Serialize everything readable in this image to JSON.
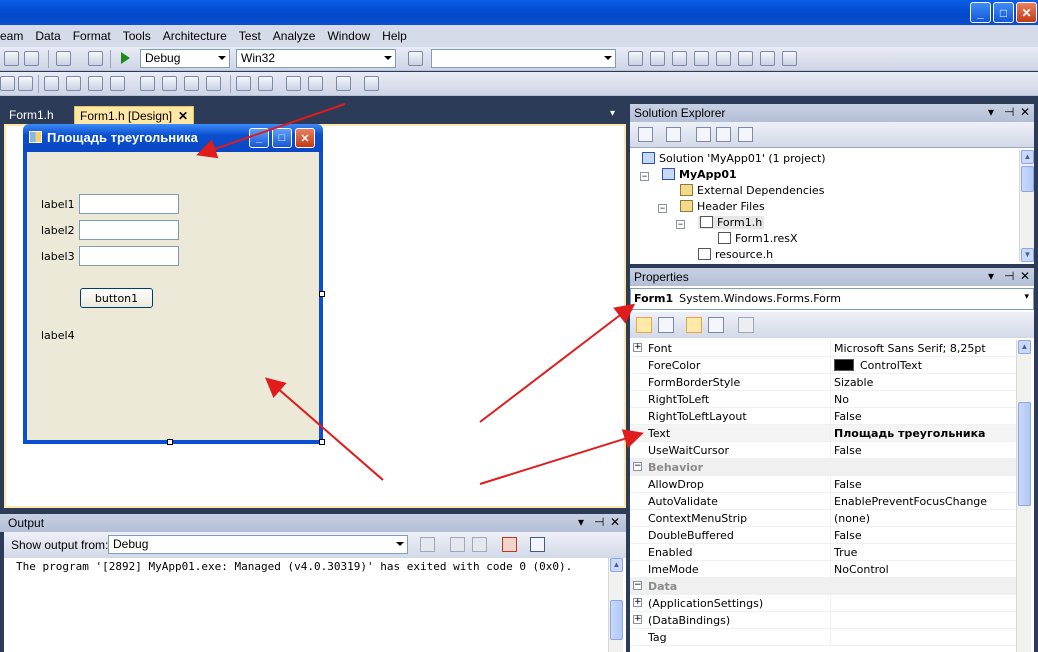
{
  "window": {
    "min": "_",
    "max": "□",
    "close": "✕"
  },
  "menu": [
    "eam",
    "Data",
    "Format",
    "Tools",
    "Architecture",
    "Test",
    "Analyze",
    "Window",
    "Help"
  ],
  "toolbar": {
    "config": "Debug",
    "platform": "Win32",
    "find": ""
  },
  "tabs": [
    {
      "label": "Form1.h"
    },
    {
      "label": "Form1.h [Design]",
      "close": "✕"
    }
  ],
  "form": {
    "title": "Площадь треугольника",
    "label1": "label1",
    "label2": "label2",
    "label3": "label3",
    "button": "button1",
    "label4": "label4"
  },
  "solution_explorer": {
    "title": "Solution Explorer",
    "items": [
      "Solution 'MyApp01' (1 project)",
      "MyApp01",
      "External Dependencies",
      "Header Files",
      "Form1.h",
      "Form1.resX",
      "resource.h"
    ]
  },
  "properties": {
    "title": "Properties",
    "object_name": "Form1",
    "object_type": "System.Windows.Forms.Form",
    "rows": [
      {
        "name": "Font",
        "value": "Microsoft Sans Serif; 8,25pt"
      },
      {
        "name": "ForeColor",
        "value": "ControlText"
      },
      {
        "name": "FormBorderStyle",
        "value": "Sizable"
      },
      {
        "name": "RightToLeft",
        "value": "No"
      },
      {
        "name": "RightToLeftLayout",
        "value": "False"
      },
      {
        "name": "Text",
        "value": "Площадь треугольника"
      },
      {
        "name": "UseWaitCursor",
        "value": "False"
      },
      {
        "category": "Behavior"
      },
      {
        "name": "AllowDrop",
        "value": "False"
      },
      {
        "name": "AutoValidate",
        "value": "EnablePreventFocusChange"
      },
      {
        "name": "ContextMenuStrip",
        "value": "(none)"
      },
      {
        "name": "DoubleBuffered",
        "value": "False"
      },
      {
        "name": "Enabled",
        "value": "True"
      },
      {
        "name": "ImeMode",
        "value": "NoControl"
      },
      {
        "category": "Data"
      },
      {
        "name": "(ApplicationSettings)",
        "value": ""
      },
      {
        "name": "(DataBindings)",
        "value": ""
      },
      {
        "name": "Tag",
        "value": ""
      }
    ]
  },
  "output": {
    "title": "Output",
    "show_label": "Show output from:",
    "source": "Debug",
    "text": "The program '[2892] MyApp01.exe: Managed (v4.0.30319)' has exited with code 0 (0x0)."
  },
  "panel_controls": {
    "dropdown": "▾",
    "pin": "⊣",
    "close": "✕"
  },
  "colors": {
    "annotation_arrows": "#e01c1c",
    "designer_frame": "#ffe8a6",
    "form_titlebar": "#0a4fd0"
  }
}
